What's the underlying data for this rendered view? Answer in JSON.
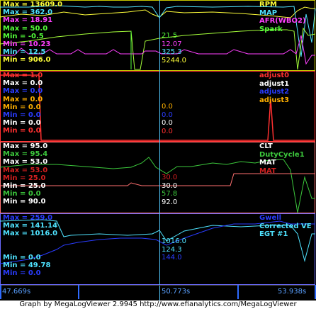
{
  "panels": [
    {
      "border": "#c8c800",
      "left": [
        {
          "text": "Max = 13609.0",
          "color": "#ffff3a"
        },
        {
          "text": "Max = 362.0",
          "color": "#4fe3ff"
        },
        {
          "text": "Max = 18.91",
          "color": "#ff40ff"
        },
        {
          "text": "Max = 50.0",
          "color": "#54ff3a"
        },
        {
          "text": "Min = -0.5",
          "color": "#54ff3a"
        },
        {
          "text": "Min = 10.23",
          "color": "#ff40ff"
        },
        {
          "text": "Min = 12.5",
          "color": "#4fe3ff"
        },
        {
          "text": "Min = 906.0",
          "color": "#ffff3a"
        }
      ],
      "right": [
        {
          "text": "RPM",
          "color": "#ffff3a"
        },
        {
          "text": "MAP",
          "color": "#4fe3ff"
        },
        {
          "text": "AFR(WBO2)",
          "color": "#ff40ff"
        },
        {
          "text": "Spark",
          "color": "#54ff3a"
        }
      ],
      "cursor": [
        {
          "text": "21.5",
          "color": "#54ff3a"
        },
        {
          "text": "12.07",
          "color": "#ff40ff"
        },
        {
          "text": "325.3",
          "color": "#4fe3ff"
        },
        {
          "text": "5244.0",
          "color": "#ffff3a"
        }
      ]
    },
    {
      "border": "#ff3030",
      "left": [
        {
          "text": "Max = 1.0",
          "color": "#ff3030"
        },
        {
          "text": "Max = 0.0",
          "color": "#ffffff"
        },
        {
          "text": "Max = 0.0",
          "color": "#2a3cff"
        },
        {
          "text": "Max = 0.0",
          "color": "#ffb000"
        },
        {
          "text": "Min = 0.0",
          "color": "#ffb000"
        },
        {
          "text": "Min = 0.0",
          "color": "#2a3cff"
        },
        {
          "text": "Min = 0.0",
          "color": "#ffffff"
        },
        {
          "text": "Min = 0.0",
          "color": "#ff3030"
        }
      ],
      "right": [
        {
          "text": "adjust0",
          "color": "#ff3030"
        },
        {
          "text": "adjust1",
          "color": "#ffffff"
        },
        {
          "text": "adjust2",
          "color": "#2a3cff"
        },
        {
          "text": "adjust3",
          "color": "#ffb000"
        }
      ],
      "cursor": [
        {
          "text": "0.0",
          "color": "#ffb000"
        },
        {
          "text": "0.0",
          "color": "#2a3cff"
        },
        {
          "text": "0.0",
          "color": "#ffffff"
        },
        {
          "text": "0.0",
          "color": "#ff3030"
        }
      ]
    },
    {
      "border": "#ff7070",
      "left": [
        {
          "text": "Max = 95.0",
          "color": "#ffffff"
        },
        {
          "text": "Max = 95.4",
          "color": "#3cc83c"
        },
        {
          "text": "Max = 53.0",
          "color": "#ffffff"
        },
        {
          "text": "Max = 53.0",
          "color": "#d42020"
        },
        {
          "text": "Min = 25.0",
          "color": "#d42020"
        },
        {
          "text": "Min = 25.0",
          "color": "#ffffff"
        },
        {
          "text": "Min = 0.0",
          "color": "#3cc83c"
        },
        {
          "text": "Min = 90.0",
          "color": "#ffffff"
        }
      ],
      "right": [
        {
          "text": "CLT",
          "color": "#ffffff"
        },
        {
          "text": "DutyCycle1",
          "color": "#3cc83c"
        },
        {
          "text": "MAT",
          "color": "#ffffff"
        },
        {
          "text": "MAT",
          "color": "#d42020"
        }
      ],
      "cursor": [
        {
          "text": "30.0",
          "color": "#d42020"
        },
        {
          "text": "30.0",
          "color": "#ffffff"
        },
        {
          "text": "57.8",
          "color": "#3cc83c"
        },
        {
          "text": "92.0",
          "color": "#ffffff"
        }
      ]
    },
    {
      "border": "#6a6aff",
      "left": [
        {
          "text": "Max = 259.0",
          "color": "#2a3cff"
        },
        {
          "text": "Max = 141.14",
          "color": "#4fe3ff"
        },
        {
          "text": "Max = 1016.0",
          "color": "#4fe3ff"
        },
        {
          "text": "",
          "color": "#4fe3ff"
        },
        {
          "text": "",
          "color": "#4fe3ff"
        },
        {
          "text": "Min = 0.0",
          "color": "#4fe3ff"
        },
        {
          "text": "Min = 49.78",
          "color": "#4fe3ff"
        },
        {
          "text": "Min = 0.0",
          "color": "#2a3cff"
        }
      ],
      "right": [
        {
          "text": "Gwell",
          "color": "#2a3cff"
        },
        {
          "text": "Corrected VE",
          "color": "#4fe3ff"
        },
        {
          "text": "EGT #1",
          "color": "#4fe3ff"
        },
        {
          "text": "",
          "color": "#4fe3ff"
        }
      ],
      "cursor": [
        {
          "text": "1016.0",
          "color": "#4fe3ff"
        },
        {
          "text": "124.3",
          "color": "#4fe3ff"
        },
        {
          "text": "144.0",
          "color": "#2a3cff"
        },
        {
          "text": "",
          "color": "#2a3cff"
        }
      ]
    }
  ],
  "time": {
    "left": "47.669s",
    "center": "50.773s",
    "right": "53.938s"
  },
  "footer": "Graph by MegaLogViewer 2.9945 http://www.efianalytics.com/MegaLogViewer"
}
